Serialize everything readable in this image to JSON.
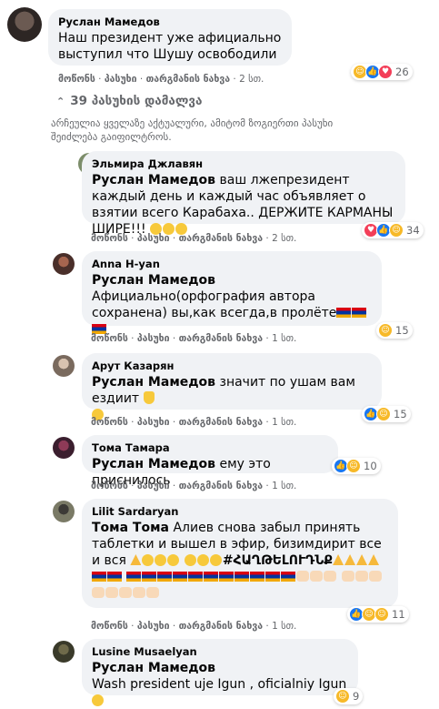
{
  "labels": {
    "like": "მოწონს",
    "reply": "პასუხი",
    "translate": "თარგმანის ნახვა",
    "dot": "·"
  },
  "colors": {
    "like": "#1877f2",
    "haha": "#f7b928",
    "love": "#f33e58",
    "bubble": "#f0f2f5"
  },
  "top_comment": {
    "author": "Руслан Мамедов",
    "text": "Наш президент уже афициально выступил что Шушу освободили",
    "time": "2 სთ.",
    "reactions": [
      "haha",
      "like",
      "love"
    ],
    "reaction_count": "26"
  },
  "thread": {
    "label": "39 პასუხის დამალვა",
    "notice": "არჩეულია ყველაზე აქტუალური, ამიტომ ზოგიერთი პასუხი შეიძლება გაიფილტროს."
  },
  "replies": [
    {
      "author": "Эльмира Джлавян",
      "mention": "Руслан Мамедов",
      "text": " ваш лжепрезидент каждый день и каждый час объявляет о взятии всего Карабаха.. ДЕРЖИТЕ КАРМАНЫ ШИРЕ!!!",
      "time": "2 სთ.",
      "reactions": [
        "love",
        "like",
        "care"
      ],
      "reaction_count": "34"
    },
    {
      "author": "Anna H-yan",
      "mention": "Руслан Мамедов",
      "text": " Афициально(орфография автора сохранена) вы,как всегда,в пролёте",
      "time": "1 სთ.",
      "reactions": [
        "haha"
      ],
      "reaction_count": "15"
    },
    {
      "author": "Арут Казарян",
      "mention": "Руслан Мамедов",
      "text": " значит по ушам вам ездиит",
      "time": "1 სთ.",
      "reactions": [
        "like",
        "haha"
      ],
      "reaction_count": "15"
    },
    {
      "author": "Тома Тамара",
      "mention": "Руслан Мамедов",
      "text": " ему это приснилось",
      "time": "1 სთ.",
      "reactions": [
        "like",
        "haha"
      ],
      "reaction_count": "10"
    },
    {
      "author": "Lilit Sardaryan",
      "mention": "Тома Тома",
      "text": " Алиев снова забыл принять таблетки и вышел в эфир, бизимдирит все и вся",
      "hashtag": "#ՀԱՂԹԵԼՈՒԴՆՔ",
      "time": "1 სთ.",
      "reactions": [
        "like",
        "haha",
        "care"
      ],
      "reaction_count": "11"
    },
    {
      "author": "Lusine Musaelyan",
      "mention": "Руслан Мамедов",
      "text": "Wash president uje Igun , oficialniy Igun",
      "time": "",
      "reactions": [
        "haha"
      ],
      "reaction_count": "9"
    }
  ]
}
